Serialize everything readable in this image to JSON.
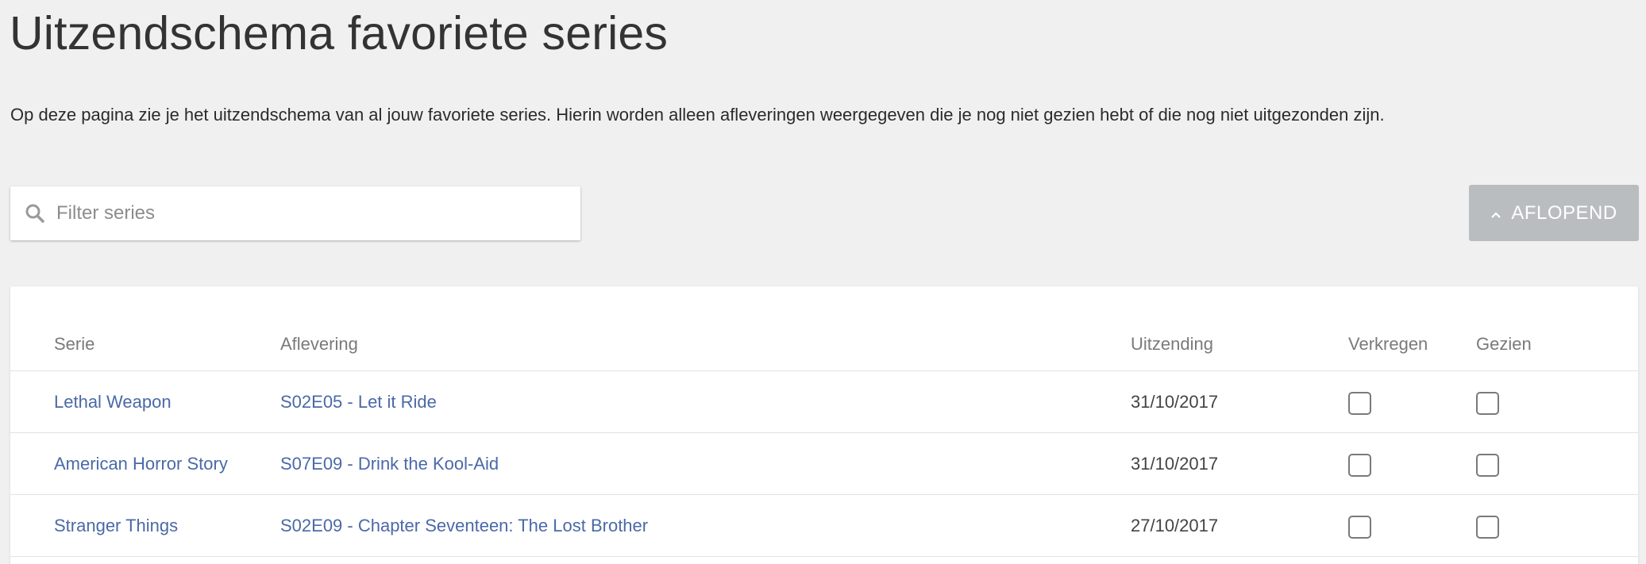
{
  "page": {
    "title": "Uitzendschema favoriete series",
    "intro": "Op deze pagina zie je het uitzendschema van al jouw favoriete series. Hierin worden alleen afleveringen weergegeven die je nog niet gezien hebt of die nog niet uitgezonden zijn."
  },
  "search": {
    "placeholder": "Filter series",
    "value": "",
    "icon": "search-icon"
  },
  "sort": {
    "label": "AFLOPEND",
    "icon": "chevron-up-icon"
  },
  "table": {
    "columns": {
      "serie": "Serie",
      "episode": "Aflevering",
      "airdate": "Uitzending",
      "obtained": "Verkregen",
      "seen": "Gezien"
    },
    "rows": [
      {
        "serie": "Lethal Weapon",
        "episode": "S02E05 - Let it Ride",
        "airdate": "31/10/2017",
        "obtained": false,
        "seen": false
      },
      {
        "serie": "American Horror Story",
        "episode": "S07E09 - Drink the Kool-Aid",
        "airdate": "31/10/2017",
        "obtained": false,
        "seen": false
      },
      {
        "serie": "Stranger Things",
        "episode": "S02E09 - Chapter Seventeen: The Lost Brother",
        "airdate": "27/10/2017",
        "obtained": false,
        "seen": false
      }
    ]
  },
  "colors": {
    "background": "#f0f0f0",
    "link": "#4a69a8",
    "sort_button": "#b9bdc0"
  }
}
